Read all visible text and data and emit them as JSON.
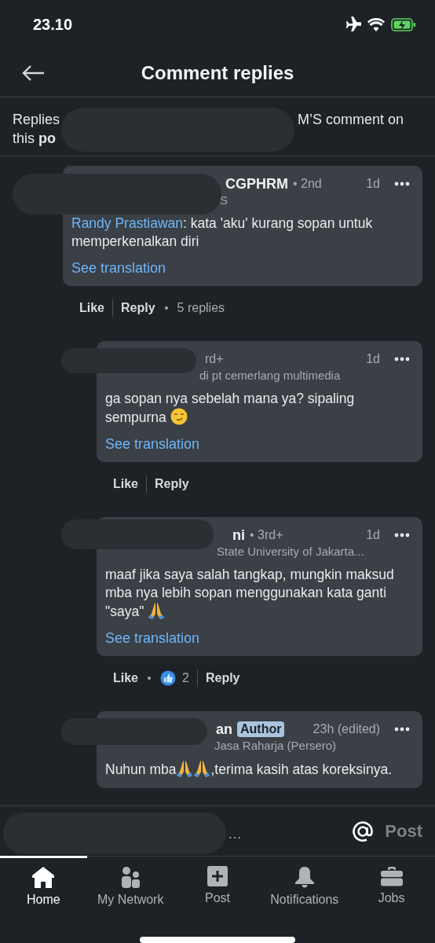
{
  "status_bar": {
    "time": "23.10"
  },
  "header": {
    "title": "Comment replies"
  },
  "context": {
    "start": "Replies",
    "end": "M’S comment on",
    "line2": "this **po**"
  },
  "comments": [
    {
      "name": "CGPHRM",
      "degree": "• 2nd",
      "time": "1d",
      "headline": "S",
      "body": [
        {
          "kind": "mention",
          "text": "Randy Prastiawan"
        },
        {
          "kind": "text",
          "text": ": kata 'aku' kurang sopan untuk memperkenalkan diri"
        }
      ],
      "translate": "See translation",
      "like": "Like",
      "reply": "Reply",
      "replies": "5 replies",
      "children": [
        {
          "degree": "rd+",
          "time": "1d",
          "headline": "di pt cemerlang multimedia",
          "body": [
            {
              "kind": "text",
              "text": "ga sopan nya sebelah mana ya? sipaling sempurna "
            },
            {
              "kind": "smirk"
            }
          ],
          "translate": "See translation",
          "like": "Like",
          "reply": "Reply"
        },
        {
          "name": "ni",
          "degree": "• 3rd+",
          "time": "1d",
          "headline": "State University of Jakarta...",
          "body": [
            {
              "kind": "text",
              "text": "maaf jika saya salah tangkap, mungkin maksud mba nya lebih sopan menggunakan kata ganti \"saya\" "
            },
            {
              "kind": "pray"
            }
          ],
          "translate": "See translation",
          "like": "Like",
          "reactions": "2",
          "reply": "Reply"
        },
        {
          "name": "an",
          "badge": "Author",
          "time": "23h (edited)",
          "headline": "Jasa Raharja (Persero)",
          "body": [
            {
              "kind": "text",
              "text": "Nuhun mba"
            },
            {
              "kind": "pray"
            },
            {
              "kind": "pray"
            },
            {
              "kind": "text",
              "text": ",terima kasih atas koreksinya."
            }
          ]
        }
      ]
    }
  ],
  "reply_field": {
    "placeholder": "…",
    "post": "Post",
    "post_disabled": true
  },
  "nav": [
    {
      "label": "Home",
      "selected": true
    },
    {
      "label": "My Network",
      "selected": false
    },
    {
      "label": "Post",
      "selected": false
    },
    {
      "label": "Notifications",
      "selected": false
    },
    {
      "label": "Jobs",
      "selected": false
    }
  ]
}
